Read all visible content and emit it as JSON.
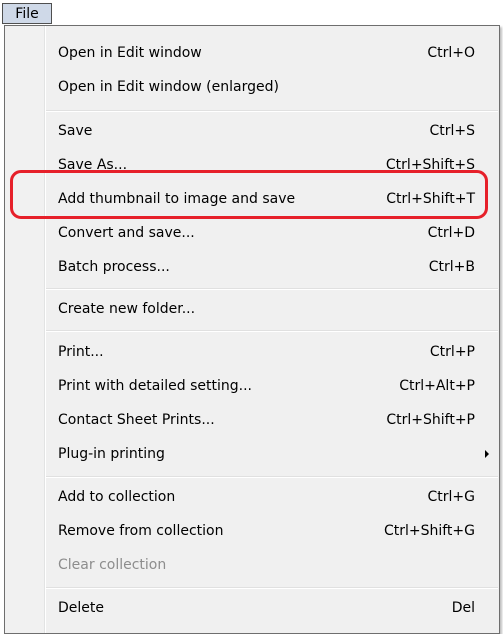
{
  "menubar": {
    "file_label": "File"
  },
  "menu": {
    "items": [
      {
        "label": "Open in Edit window",
        "shortcut": "Ctrl+O"
      },
      {
        "label": "Open in Edit window (enlarged)",
        "shortcut": ""
      },
      {
        "label": "Save",
        "shortcut": "Ctrl+S"
      },
      {
        "label": "Save As...",
        "shortcut": "Ctrl+Shift+S"
      },
      {
        "label": "Add thumbnail to image and save",
        "shortcut": "Ctrl+Shift+T"
      },
      {
        "label": "Convert and save...",
        "shortcut": "Ctrl+D"
      },
      {
        "label": "Batch process...",
        "shortcut": "Ctrl+B"
      },
      {
        "label": "Create new folder...",
        "shortcut": ""
      },
      {
        "label": "Print...",
        "shortcut": "Ctrl+P"
      },
      {
        "label": "Print with detailed setting...",
        "shortcut": "Ctrl+Alt+P"
      },
      {
        "label": "Contact Sheet Prints...",
        "shortcut": "Ctrl+Shift+P"
      },
      {
        "label": "Plug-in printing",
        "shortcut": ""
      },
      {
        "label": "Add to collection",
        "shortcut": "Ctrl+G"
      },
      {
        "label": "Remove from collection",
        "shortcut": "Ctrl+Shift+G"
      },
      {
        "label": "Clear collection",
        "shortcut": "",
        "disabled": true
      },
      {
        "label": "Delete",
        "shortcut": "Del"
      }
    ]
  },
  "colors": {
    "highlight_ring": "#e6202a",
    "menu_background": "#f0f0f0"
  }
}
